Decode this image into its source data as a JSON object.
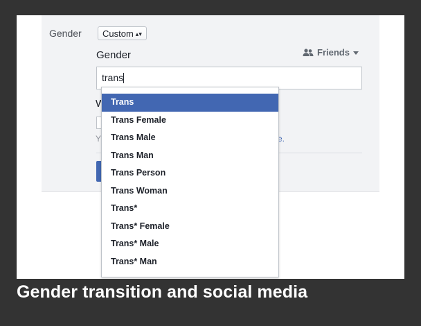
{
  "form": {
    "gender_label": "Gender",
    "select_value": "Custom",
    "select_arrows": "▴▾",
    "custom_label": "Gender",
    "audience": {
      "label": "Friends",
      "icon": "friends-icon",
      "color": "#606770"
    },
    "input_value": "trans",
    "partial_next_label": "W",
    "partial_help_start": "Y",
    "partial_link_end": "re."
  },
  "suggestions": [
    {
      "label": "Trans",
      "selected": true
    },
    {
      "label": "Trans Female",
      "selected": false
    },
    {
      "label": "Trans Male",
      "selected": false
    },
    {
      "label": "Trans Man",
      "selected": false
    },
    {
      "label": "Trans Person",
      "selected": false
    },
    {
      "label": "Trans Woman",
      "selected": false
    },
    {
      "label": "Trans*",
      "selected": false
    },
    {
      "label": "Trans* Female",
      "selected": false
    },
    {
      "label": "Trans* Male",
      "selected": false
    },
    {
      "label": "Trans* Man",
      "selected": false
    }
  ],
  "caption": "Gender transition and social media",
  "colors": {
    "accent": "#4267b2",
    "page_background": "#333333",
    "caption_text": "#ffffff"
  }
}
